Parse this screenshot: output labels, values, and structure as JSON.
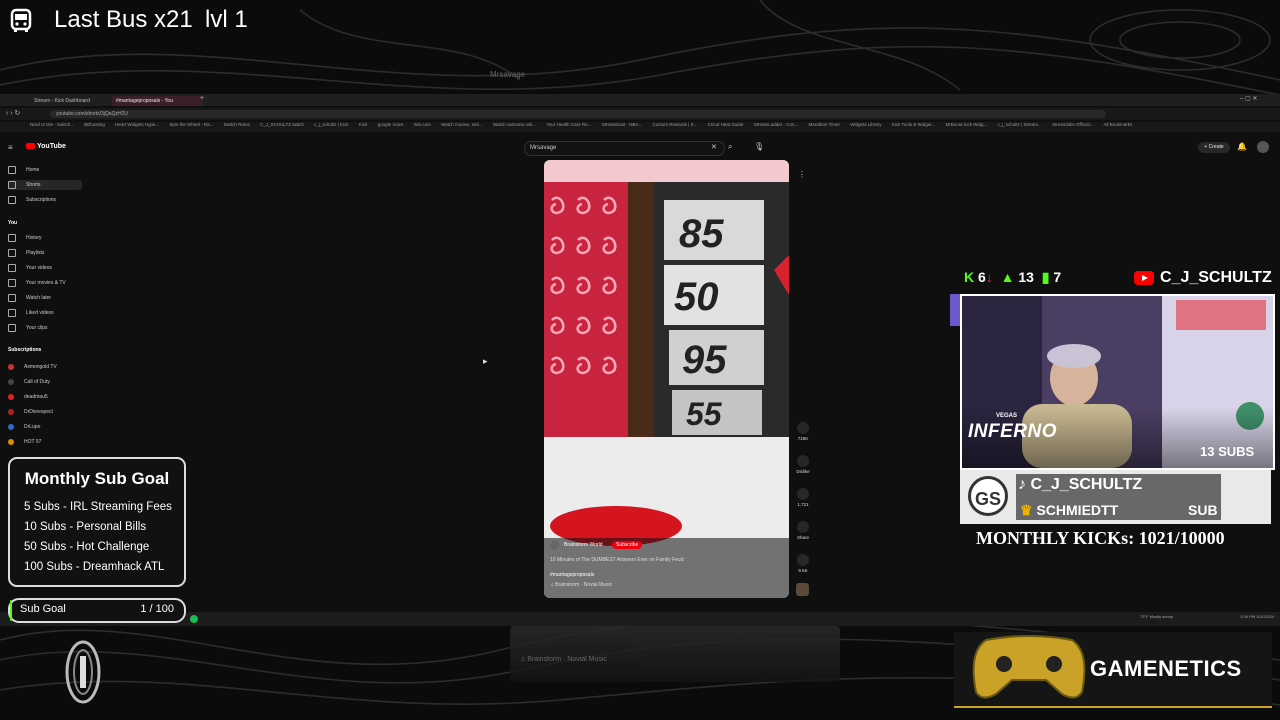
{
  "stream_header": {
    "title": "Last Bus",
    "multiplier": "x21",
    "level": "lvl 1"
  },
  "ghost": {
    "search": "Mrsavage"
  },
  "browser": {
    "tabs": [
      {
        "label": "Stream - Kick Dashboard",
        "active": false
      },
      {
        "label": "#marriageproposals - You",
        "active": true
      }
    ],
    "url": "youtube.com/shorts/3jQaQzH2U",
    "bookmarks": [
      "Nerd or Die - Switch...",
      "BEhosting",
      "Heart Widgets Hype...",
      "Spin the Wheel - Ra...",
      "Switch Rams",
      "C_J_SCHULTZ twitch",
      "c_j_schultz | Kick",
      "Kick",
      "google Voice",
      "Wix.com",
      "Watch movies, seri...",
      "Watch cartoons onli...",
      "Your Health Care Re...",
      "StreamEast - NBA...",
      "Custom Rewards | K...",
      "Cricut Heat Guide",
      "StreamLadder - Con...",
      "Marathon Timer",
      "Widgets Library",
      "Kick Tools & Widget...",
      "MrBoost Kick Widg...",
      "c_j_schultz | Stream...",
      "Streamlabs Official...",
      "All Bookmarks"
    ]
  },
  "youtube": {
    "logo": "YouTube",
    "search_value": "Mrsavage",
    "create_label": "+ Create",
    "sidebar": {
      "main": [
        {
          "label": "Home",
          "selected": false
        },
        {
          "label": "Shorts",
          "selected": true
        },
        {
          "label": "Subscriptions",
          "selected": false
        }
      ],
      "you_heading": "You",
      "you": [
        "History",
        "Playlists",
        "Your videos",
        "Your movies & TV",
        "Watch later",
        "Liked videos",
        "Your clips"
      ],
      "subs_heading": "Subscriptions",
      "subscriptions": [
        {
          "label": "Asmongold TV",
          "color": "#c33"
        },
        {
          "label": "Call of Duty",
          "color": "#444"
        },
        {
          "label": "deadmau5",
          "color": "#d22"
        },
        {
          "label": "DrDisrespect",
          "color": "#a22"
        },
        {
          "label": "DrLupo",
          "color": "#2b6ad4"
        },
        {
          "label": "HOT 97",
          "color": "#e08a00"
        }
      ]
    },
    "short": {
      "wheel_numbers": [
        "85",
        "50",
        "95",
        "55"
      ],
      "channel": "Brainstorm World",
      "subscribe": "Subscribe",
      "title": "10 Minutes of The DUMBEST Answers Ever on Family Feud",
      "hashtag": "#marriageproposals",
      "music": "♫ Brainstorm · Novial Music"
    },
    "rail": [
      {
        "label": "726K",
        "icon": "like-icon"
      },
      {
        "label": "Dislike",
        "icon": "dislike-icon"
      },
      {
        "label": "1,721",
        "icon": "comment-icon"
      },
      {
        "label": "Share",
        "icon": "share-icon"
      },
      {
        "label": "9.6K",
        "icon": "remix-icon"
      }
    ]
  },
  "taskbar": {
    "weather": "73°F Mostly sunny",
    "clock": "3:39 PM 10/1/2024"
  },
  "reflection": {
    "music": "♫ Brainstorm · Novial Music"
  },
  "sub_goal": {
    "title": "Monthly Sub Goal",
    "items": [
      "5 Subs - IRL Streaming Fees",
      "10 Subs - Personal Bills",
      "50 Subs - Hot Challenge",
      "100 Subs - Dreamhack ATL"
    ],
    "bar_label": "Sub Goal",
    "bar_value": "1 / 100",
    "progress": 0.01
  },
  "stats": {
    "kick": "6",
    "followers": "13",
    "viewers": "7",
    "channel": "C_J_SCHULTZ"
  },
  "webcam": {
    "brand_small": "VEGAS",
    "brand": "INFERNO",
    "subs": "13 SUBS"
  },
  "namecard": {
    "logo": "GS",
    "tiktok": "C_J_SCHULTZ",
    "latest": "SCHMIEDTT",
    "latest_type": "SUB"
  },
  "kicks": {
    "text": "MONTHLY KICKs: 1021/10000"
  },
  "sponsor": {
    "name": "GAMENETICS"
  },
  "colors": {
    "accent_red": "#ff0000",
    "kick_green": "#53fc18",
    "bg": "#0b0b0c"
  }
}
